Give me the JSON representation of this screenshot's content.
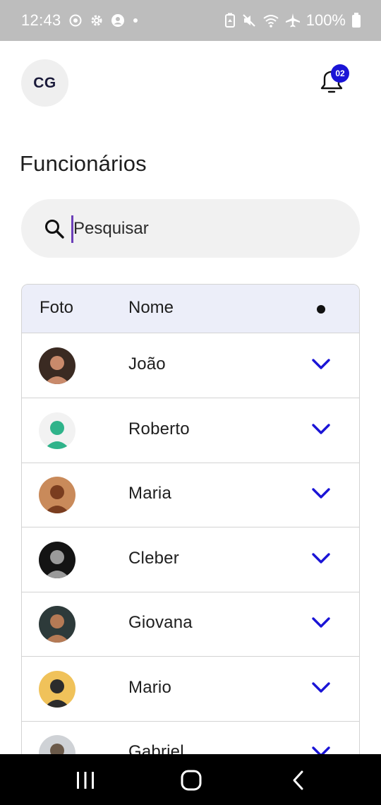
{
  "status_bar": {
    "time": "12:43",
    "battery": "100%",
    "left_icons": [
      "location-circle-icon",
      "settings-gear-icon",
      "account-circle-icon",
      "notification-dot-icon"
    ],
    "right_icons": [
      "battery-saver-icon",
      "mute-icon",
      "wifi-icon",
      "airplane-mode-icon",
      "battery-icon"
    ]
  },
  "header": {
    "user_initials": "CG",
    "notification_count": "02"
  },
  "page": {
    "title": "Funcionários"
  },
  "search": {
    "placeholder": "Pesquisar",
    "value": ""
  },
  "table": {
    "columns": [
      "Foto",
      "Nome",
      "●"
    ],
    "rows": [
      {
        "name": "João",
        "avatar_colors": [
          "#3a2a22",
          "#c98a6b"
        ]
      },
      {
        "name": "Roberto",
        "avatar_colors": [
          "#f2f2f2",
          "#2fb38a"
        ]
      },
      {
        "name": "Maria",
        "avatar_colors": [
          "#c98a5a",
          "#7a3d1f"
        ]
      },
      {
        "name": "Cleber",
        "avatar_colors": [
          "#141414",
          "#9a9a9a"
        ]
      },
      {
        "name": "Giovana",
        "avatar_colors": [
          "#2d3a3a",
          "#b57a55"
        ]
      },
      {
        "name": "Mario",
        "avatar_colors": [
          "#f0c25a",
          "#2c2c2c"
        ]
      },
      {
        "name": "Gabriel",
        "avatar_colors": [
          "#cfd2d6",
          "#6b5a4a"
        ]
      }
    ]
  },
  "colors": {
    "accent": "#1a14d6",
    "table_header_bg": "#eceef9",
    "search_bg": "#f1f1f1",
    "status_bar_bg": "#bdbdbd",
    "caret": "#6b3fb8"
  },
  "nav_bar": {
    "buttons": [
      "recent-apps-icon",
      "home-icon",
      "back-icon"
    ]
  }
}
